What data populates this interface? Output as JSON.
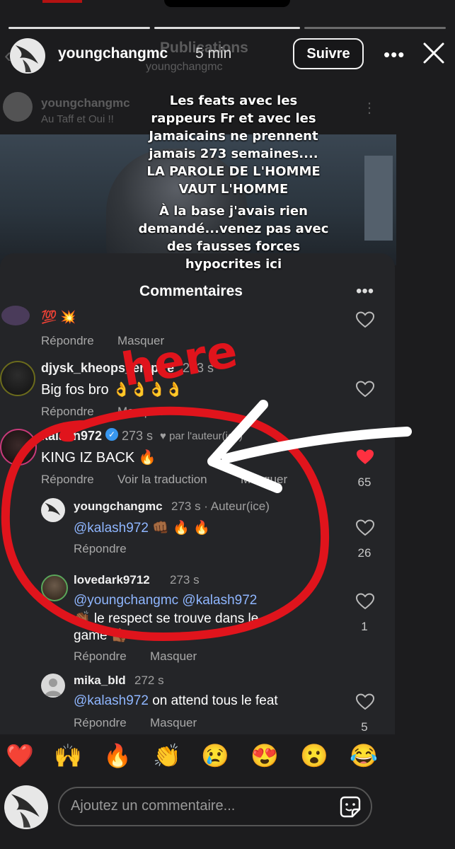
{
  "story": {
    "username": "youngchangmc",
    "time": "5 min",
    "follow_label": "Suivre",
    "more_label": "•••"
  },
  "background": {
    "page_title": "Publications",
    "page_subtitle": "youngchangmc",
    "post_user": "youngchangmc",
    "post_caption": "Au Taff et Oui !!"
  },
  "caption_lines": [
    "Les feats avec les",
    "rappeurs Fr et avec les",
    "Jamaicains ne prennent",
    "jamais 273 semaines....",
    "LA PAROLE DE L'HOMME",
    "VAUT L'HOMME",
    "À la base j'avais rien",
    "demandé...venez pas avec",
    "des fausses forces",
    "hypocrites ici"
  ],
  "annotation": "here",
  "comments_panel": {
    "title": "Commentaires",
    "more_label": "•••",
    "reply_label": "Répondre",
    "hide_label": "Masquer",
    "translate_label": "Voir la traduction",
    "c0": {
      "text": "💯 💥"
    },
    "c1": {
      "user": "djysk_kheops_empire",
      "meta": "273 s",
      "text": "Big fos bro 👌👌👌👌"
    },
    "c2": {
      "user": "kalash972",
      "meta": "273 s",
      "liked": "♥ par l'auteur(ice)",
      "text": "KING IZ BACK 🔥",
      "likes": "65"
    },
    "c3": {
      "user": "youngchangmc",
      "meta": "273 s · Auteur(ice)",
      "mention": "@kalash972",
      "text": " 👊🏾 🔥 🔥",
      "likes": "26"
    },
    "c4": {
      "user": "lovedark9712",
      "meta": "273 s",
      "mention": "@youngchangmc @kalash972",
      "text_line2": "👏🏾 le respect se trouve dans le",
      "text_line3": "game 👍🏾",
      "likes": "1"
    },
    "c5": {
      "user": "mika_bld",
      "meta": "272 s",
      "mention": "@kalash972",
      "text": " on attend tous le feat",
      "likes": "5"
    }
  },
  "reactions": [
    "❤️",
    "🙌",
    "🔥",
    "👏",
    "😢",
    "😍",
    "😮",
    "😂"
  ],
  "reply_input": {
    "placeholder": "Ajoutez un commentaire..."
  },
  "colors": {
    "accent_red": "#e0141c",
    "like_red": "#ff3040",
    "mention_blue": "#8fb6ff"
  }
}
